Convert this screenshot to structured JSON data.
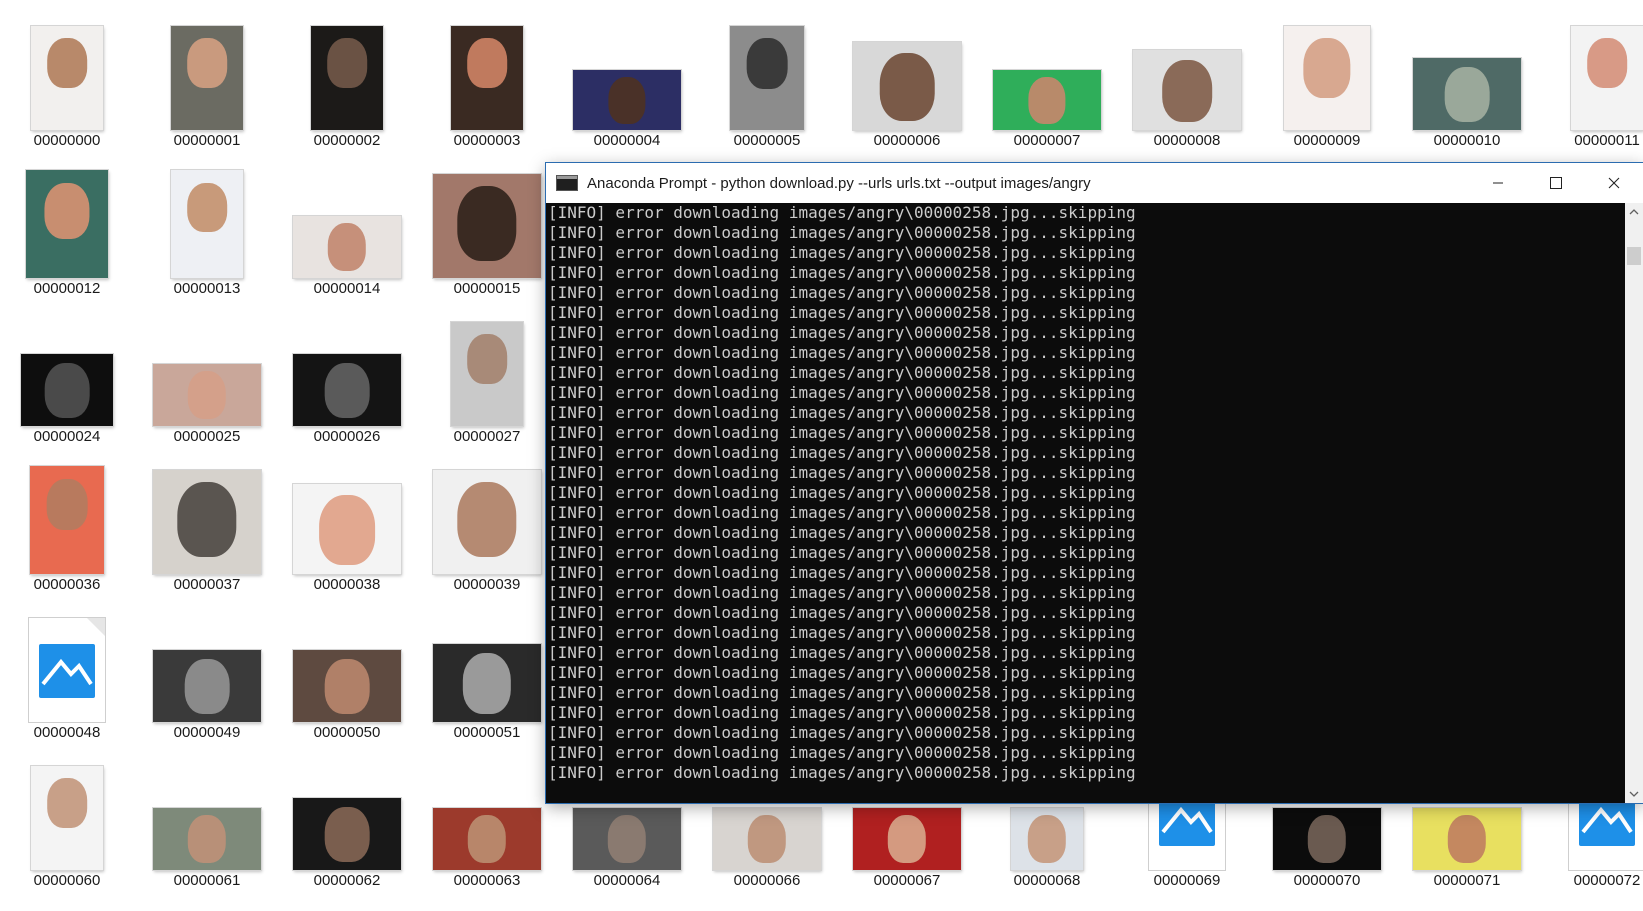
{
  "explorer": {
    "files": [
      {
        "name": "00000000",
        "kind": "photo",
        "thumb": {
          "bg": "#f2f0ee",
          "fg": "#b8896a"
        }
      },
      {
        "name": "00000001",
        "kind": "photo",
        "thumb": {
          "bg": "#6b6b62",
          "fg": "#c99a7e"
        }
      },
      {
        "name": "00000002",
        "kind": "photo",
        "thumb": {
          "bg": "#1c1a18",
          "fg": "#6a5244"
        }
      },
      {
        "name": "00000003",
        "kind": "photo",
        "thumb": {
          "bg": "#3a2a22",
          "fg": "#c07a5e"
        }
      },
      {
        "name": "00000004",
        "kind": "photo",
        "thumb": {
          "bg": "#2c2e64",
          "fg": "#4a3128"
        }
      },
      {
        "name": "00000005",
        "kind": "photo",
        "thumb": {
          "bg": "#8c8c8c",
          "fg": "#3a3a3a"
        }
      },
      {
        "name": "00000006",
        "kind": "photo",
        "thumb": {
          "bg": "#d8d8d8",
          "fg": "#7a5a48"
        }
      },
      {
        "name": "00000007",
        "kind": "photo",
        "thumb": {
          "bg": "#2fae5a",
          "fg": "#b88a6a"
        }
      },
      {
        "name": "00000008",
        "kind": "photo",
        "thumb": {
          "bg": "#e0e0e0",
          "fg": "#8a6a58"
        }
      },
      {
        "name": "00000009",
        "kind": "photo",
        "thumb": {
          "bg": "#f5f0ee",
          "fg": "#d8a890"
        }
      },
      {
        "name": "00000010",
        "kind": "photo",
        "thumb": {
          "bg": "#4f6a66",
          "fg": "#9aa89a"
        }
      },
      {
        "name": "00000011",
        "kind": "photo",
        "thumb": {
          "bg": "#f3f3f3",
          "fg": "#d89a86"
        }
      },
      {
        "name": "00000012",
        "kind": "photo",
        "thumb": {
          "bg": "#3a6e62",
          "fg": "#c88e70"
        }
      },
      {
        "name": "00000013",
        "kind": "photo",
        "thumb": {
          "bg": "#eef0f4",
          "fg": "#c89a7a"
        }
      },
      {
        "name": "00000014",
        "kind": "photo",
        "thumb": {
          "bg": "#e8e3e0",
          "fg": "#c6907a"
        }
      },
      {
        "name": "00000015",
        "kind": "photo",
        "thumb": {
          "bg": "#a2786a",
          "fg": "#3a2a22"
        }
      },
      {
        "name": "00000024",
        "kind": "photo",
        "thumb": {
          "bg": "#0e0e0e",
          "fg": "#4a4a4a"
        }
      },
      {
        "name": "00000025",
        "kind": "photo",
        "thumb": {
          "bg": "#c9a79a",
          "fg": "#d4a08a"
        }
      },
      {
        "name": "00000026",
        "kind": "photo",
        "thumb": {
          "bg": "#141414",
          "fg": "#5a5a5a"
        }
      },
      {
        "name": "00000027",
        "kind": "photo",
        "thumb": {
          "bg": "#c9c9c9",
          "fg": "#a88a78"
        }
      },
      {
        "name": "00000036",
        "kind": "photo",
        "thumb": {
          "bg": "#e86a50",
          "fg": "#b87a5e"
        }
      },
      {
        "name": "00000037",
        "kind": "photo",
        "thumb": {
          "bg": "#d6d2cc",
          "fg": "#5a5550"
        }
      },
      {
        "name": "00000038",
        "kind": "photo",
        "thumb": {
          "bg": "#f4f4f4",
          "fg": "#e2a890"
        }
      },
      {
        "name": "00000039",
        "kind": "photo",
        "thumb": {
          "bg": "#f0f0f0",
          "fg": "#b58a72"
        }
      },
      {
        "name": "00000048",
        "kind": "file-icon"
      },
      {
        "name": "00000049",
        "kind": "photo",
        "thumb": {
          "bg": "#3a3a3a",
          "fg": "#8a8a8a"
        }
      },
      {
        "name": "00000050",
        "kind": "photo",
        "thumb": {
          "bg": "#5e4a40",
          "fg": "#b08068"
        }
      },
      {
        "name": "00000051",
        "kind": "photo",
        "thumb": {
          "bg": "#2a2a2a",
          "fg": "#9a9a9a"
        }
      },
      {
        "name": "00000060",
        "kind": "photo",
        "thumb": {
          "bg": "#f4f4f4",
          "fg": "#c8a088"
        }
      },
      {
        "name": "00000061",
        "kind": "photo",
        "thumb": {
          "bg": "#7e8a7a",
          "fg": "#b89078"
        }
      },
      {
        "name": "00000062",
        "kind": "photo",
        "thumb": {
          "bg": "#181818",
          "fg": "#7a5e4e"
        }
      },
      {
        "name": "00000063",
        "kind": "photo",
        "thumb": {
          "bg": "#9c3a2c",
          "fg": "#b8866a"
        }
      },
      {
        "name": "00000064",
        "kind": "photo",
        "thumb": {
          "bg": "#5a5a5a",
          "fg": "#8a7a70"
        }
      },
      {
        "name": "00000066",
        "kind": "photo",
        "thumb": {
          "bg": "#d8d4d0",
          "fg": "#c09880"
        }
      },
      {
        "name": "00000067",
        "kind": "photo",
        "thumb": {
          "bg": "#b02020",
          "fg": "#d49a80"
        }
      },
      {
        "name": "00000068",
        "kind": "photo",
        "thumb": {
          "bg": "#dde2e8",
          "fg": "#c8a088"
        }
      },
      {
        "name": "00000069",
        "kind": "file-icon"
      },
      {
        "name": "00000070",
        "kind": "photo",
        "thumb": {
          "bg": "#0c0c0c",
          "fg": "#6a5a50"
        }
      },
      {
        "name": "00000071",
        "kind": "photo",
        "thumb": {
          "bg": "#e8e060",
          "fg": "#c48860"
        }
      },
      {
        "name": "00000072",
        "kind": "file-icon"
      }
    ]
  },
  "console": {
    "title": "Anaconda Prompt - python  download.py --urls urls.txt --output images/angry",
    "icon": "console-icon",
    "buttons": {
      "minimize": "minimize-icon",
      "maximize": "maximize-icon",
      "close": "close-icon"
    },
    "lines": [
      "[INFO] error downloading images/angry\\00000258.jpg...skipping",
      "[INFO] error downloading images/angry\\00000258.jpg...skipping",
      "[INFO] error downloading images/angry\\00000258.jpg...skipping",
      "[INFO] error downloading images/angry\\00000258.jpg...skipping",
      "[INFO] error downloading images/angry\\00000258.jpg...skipping",
      "[INFO] error downloading images/angry\\00000258.jpg...skipping",
      "[INFO] error downloading images/angry\\00000258.jpg...skipping",
      "[INFO] error downloading images/angry\\00000258.jpg...skipping",
      "[INFO] error downloading images/angry\\00000258.jpg...skipping",
      "[INFO] error downloading images/angry\\00000258.jpg...skipping",
      "[INFO] error downloading images/angry\\00000258.jpg...skipping",
      "[INFO] error downloading images/angry\\00000258.jpg...skipping",
      "[INFO] error downloading images/angry\\00000258.jpg...skipping",
      "[INFO] error downloading images/angry\\00000258.jpg...skipping",
      "[INFO] error downloading images/angry\\00000258.jpg...skipping",
      "[INFO] error downloading images/angry\\00000258.jpg...skipping",
      "[INFO] error downloading images/angry\\00000258.jpg...skipping",
      "[INFO] error downloading images/angry\\00000258.jpg...skipping",
      "[INFO] error downloading images/angry\\00000258.jpg...skipping",
      "[INFO] error downloading images/angry\\00000258.jpg...skipping",
      "[INFO] error downloading images/angry\\00000258.jpg...skipping",
      "[INFO] error downloading images/angry\\00000258.jpg...skipping",
      "[INFO] error downloading images/angry\\00000258.jpg...skipping",
      "[INFO] error downloading images/angry\\00000258.jpg...skipping",
      "[INFO] error downloading images/angry\\00000258.jpg...skipping",
      "[INFO] error downloading images/angry\\00000258.jpg...skipping",
      "[INFO] error downloading images/angry\\00000258.jpg...skipping",
      "[INFO] error downloading images/angry\\00000258.jpg...skipping",
      "[INFO] error downloading images/angry\\00000258.jpg...skipping"
    ]
  },
  "colors": {
    "console_bg": "#0c0c0c",
    "console_text": "#cccccc",
    "file_icon_blue": "#1e90e8",
    "window_border": "#2b6cb0"
  }
}
